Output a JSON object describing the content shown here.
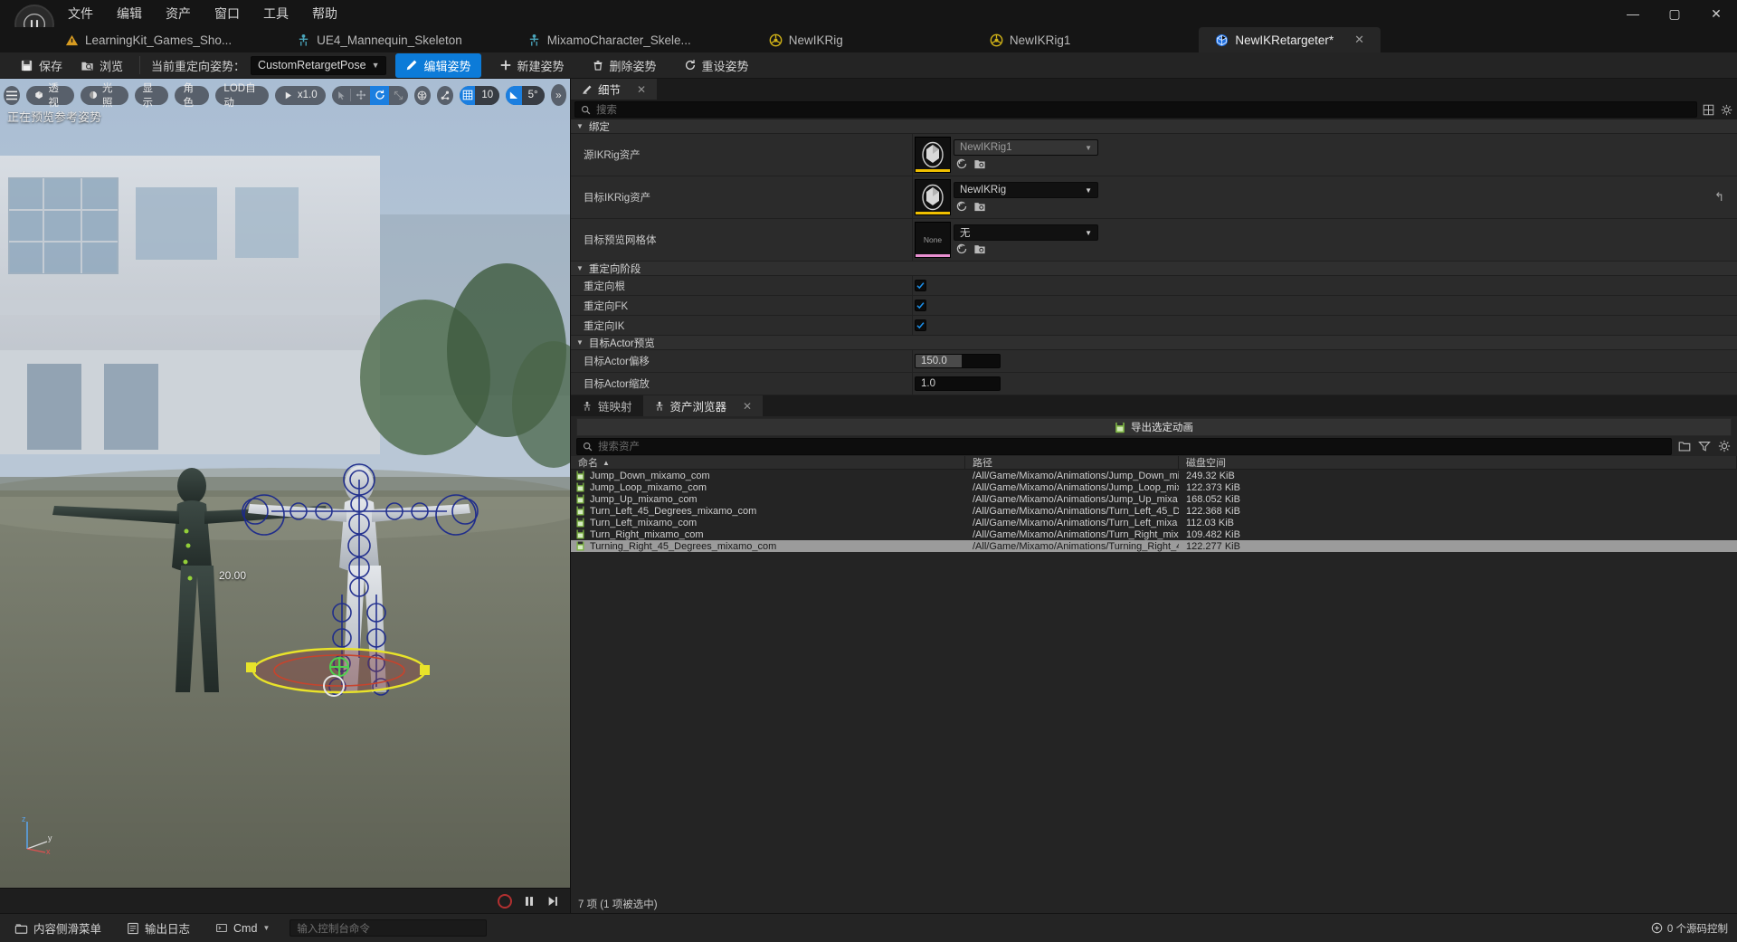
{
  "window": {
    "menu": [
      "文件",
      "编辑",
      "资产",
      "窗口",
      "工具",
      "帮助"
    ],
    "minimize": "—",
    "maximize": "▢",
    "close": "✕"
  },
  "tabs": [
    {
      "label": "LearningKit_Games_Sho...",
      "icon": "warning-triangle-icon",
      "active": false,
      "closable": false
    },
    {
      "label": "UE4_Mannequin_Skeleton",
      "icon": "skeleton-icon",
      "active": false,
      "closable": false
    },
    {
      "label": "MixamoCharacter_Skele...",
      "icon": "skeleton-icon",
      "active": false,
      "closable": false
    },
    {
      "label": "NewIKRig",
      "icon": "ikrig-icon",
      "active": false,
      "closable": false
    },
    {
      "label": "NewIKRig1",
      "icon": "ikrig-icon",
      "active": false,
      "closable": false
    },
    {
      "label": "NewIKRetargeter*",
      "icon": "ikretargeter-icon",
      "active": true,
      "closable": true,
      "close": "✕"
    }
  ],
  "toolbar": {
    "save": "保存",
    "browse": "浏览",
    "current_pose_label": "当前重定向姿势：",
    "pose_combo_value": "CustomRetargetPose",
    "edit_pose": "编辑姿势",
    "new_pose": "新建姿势",
    "delete_pose": "删除姿势",
    "reset_pose": "重设姿势"
  },
  "viewport": {
    "menu_icon": "hamburger-icon",
    "perspective": "透视",
    "lighting": "光照",
    "show": "显示",
    "character": "角色",
    "lod": "LOD自动",
    "playrate": "x1.0",
    "grid_snap": "10",
    "angle_snap": "5°",
    "expand": "»",
    "status_text": "正在预览参考姿势",
    "floor_number": "20.00",
    "axis_x": "x",
    "axis_y": "y",
    "axis_z": "z"
  },
  "details": {
    "tab_label": "细节",
    "tab_close": "✕",
    "search_placeholder": "搜索",
    "sections": [
      {
        "title": "绑定",
        "rows": [
          {
            "label": "源IKRig资产",
            "type": "asset",
            "value": "NewIKRig1",
            "thumb_accent": "#f0c000",
            "dim": true
          },
          {
            "label": "目标IKRig资产",
            "type": "asset",
            "value": "NewIKRig",
            "thumb_accent": "#f0c000",
            "dim": false
          },
          {
            "label": "目标预览网格体",
            "type": "asset",
            "value": "无",
            "thumb_text": "None",
            "thumb_accent": "#e88fd0",
            "dim": false
          }
        ]
      },
      {
        "title": "重定向阶段",
        "rows": [
          {
            "label": "重定向根",
            "type": "checkbox",
            "checked": true
          },
          {
            "label": "重定向FK",
            "type": "checkbox",
            "checked": true
          },
          {
            "label": "重定向IK",
            "type": "checkbox",
            "checked": true
          }
        ]
      },
      {
        "title": "目标Actor预览",
        "rows": [
          {
            "label": "目标Actor偏移",
            "type": "number",
            "value": "150.0",
            "fill_pct": 55
          },
          {
            "label": "目标Actor缩放",
            "type": "number",
            "value": "1.0",
            "fill_pct": 0
          }
        ]
      }
    ]
  },
  "browser": {
    "tabs": [
      {
        "label": "链映射",
        "active": false,
        "closable": false
      },
      {
        "label": "资产浏览器",
        "active": true,
        "closable": true,
        "close": "✕"
      }
    ],
    "export_button": "导出选定动画",
    "search_placeholder": "搜索资产",
    "columns": [
      {
        "key": "name",
        "label": "命名",
        "sort": "▲"
      },
      {
        "key": "path",
        "label": "路径",
        "sort": ""
      },
      {
        "key": "disk",
        "label": "磁盘空间",
        "sort": ""
      }
    ],
    "rows": [
      {
        "name": "Jump_Down_mixamo_com",
        "path": "/All/Game/Mixamo/Animations/Jump_Down_mi",
        "disk": "249.32 KiB",
        "selected": false
      },
      {
        "name": "Jump_Loop_mixamo_com",
        "path": "/All/Game/Mixamo/Animations/Jump_Loop_mix",
        "disk": "122.373 KiB",
        "selected": false
      },
      {
        "name": "Jump_Up_mixamo_com",
        "path": "/All/Game/Mixamo/Animations/Jump_Up_mixa",
        "disk": "168.052 KiB",
        "selected": false
      },
      {
        "name": "Turn_Left_45_Degrees_mixamo_com",
        "path": "/All/Game/Mixamo/Animations/Turn_Left_45_D",
        "disk": "122.368 KiB",
        "selected": false
      },
      {
        "name": "Turn_Left_mixamo_com",
        "path": "/All/Game/Mixamo/Animations/Turn_Left_mixa",
        "disk": "112.03 KiB",
        "selected": false
      },
      {
        "name": "Turn_Right_mixamo_com",
        "path": "/All/Game/Mixamo/Animations/Turn_Right_mix",
        "disk": "109.482 KiB",
        "selected": false
      },
      {
        "name": "Turning_Right_45_Degrees_mixamo_com",
        "path": "/All/Game/Mixamo/Animations/Turning_Right_4",
        "disk": "122.277 KiB",
        "selected": true
      }
    ],
    "footer": "7 项 (1 项被选中)"
  },
  "statusbar": {
    "content_drawer": "内容侧滑菜单",
    "output_log": "输出日志",
    "cmd_label": "Cmd",
    "cmd_placeholder": "输入控制台命令",
    "right_text": "0 个源码控制"
  },
  "colors": {
    "accent_blue": "#0c7bd8",
    "thumb_yellow": "#f0c000",
    "thumb_pink": "#e88fd0",
    "selection_gray": "#9b9b9b",
    "anim_green": "#7cb342"
  }
}
